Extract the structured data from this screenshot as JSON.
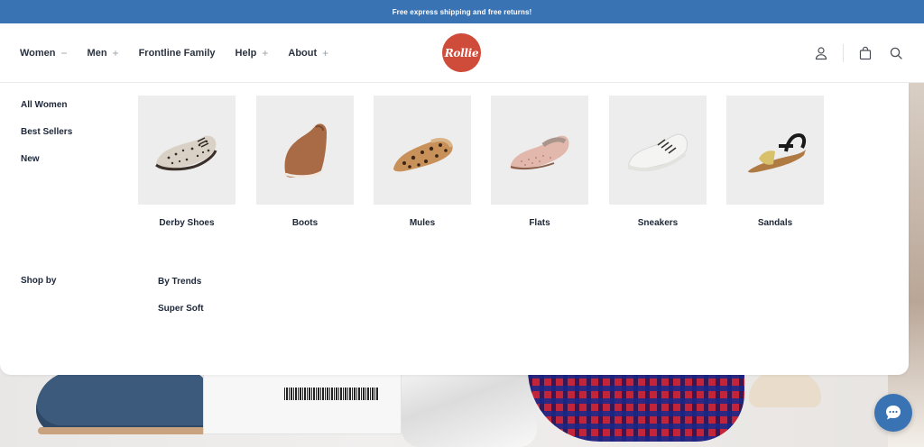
{
  "promo": {
    "text": "Free express shipping and free returns!"
  },
  "nav": [
    {
      "label": "Women",
      "symbol": "−"
    },
    {
      "label": "Men",
      "symbol": "+"
    },
    {
      "label": "Frontline Family",
      "symbol": ""
    },
    {
      "label": "Help",
      "symbol": "+"
    },
    {
      "label": "About",
      "symbol": "+"
    }
  ],
  "logo": {
    "text": "Rollie"
  },
  "icons": {
    "account": "user-icon",
    "cart": "shopping-bag-icon",
    "search": "search-icon"
  },
  "menu": {
    "side_links": [
      "All Women",
      "Best Sellers",
      "New"
    ],
    "categories": [
      "Derby Shoes",
      "Boots",
      "Mules",
      "Flats",
      "Sneakers",
      "Sandals"
    ],
    "shop_by_label": "Shop by",
    "trends": [
      "By Trends",
      "Super Soft"
    ]
  },
  "colors": {
    "promo_bar": "#3a73b3",
    "logo": "#cf4b3a",
    "chat_button": "#3a73b3"
  },
  "chat": {
    "icon": "chat-bubble-icon"
  }
}
